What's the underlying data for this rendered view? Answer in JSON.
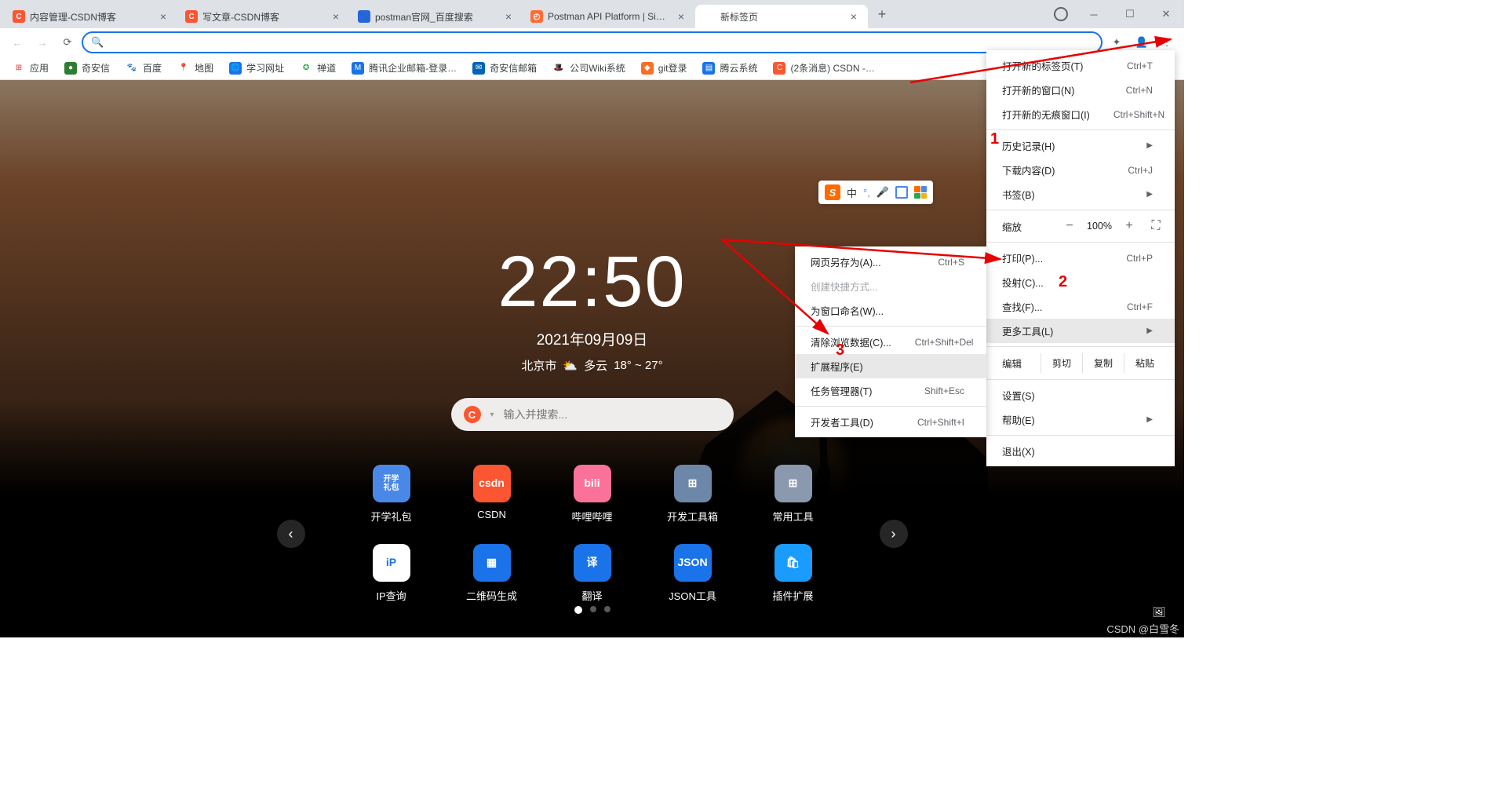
{
  "tabs": [
    {
      "title": "内容管理-CSDN博客",
      "favicon_bg": "#fc5531",
      "favicon_text": "C"
    },
    {
      "title": "写文章-CSDN博客",
      "favicon_bg": "#fc5531",
      "favicon_text": "C"
    },
    {
      "title": "postman官网_百度搜索",
      "favicon_bg": "#2a64dc",
      "favicon_text": "🐾"
    },
    {
      "title": "Postman API Platform | Sign U",
      "favicon_bg": "#ff6c37",
      "favicon_text": "◴"
    },
    {
      "title": "新标签页",
      "favicon_bg": "transparent",
      "favicon_text": "",
      "active": true
    }
  ],
  "bookmarks": [
    {
      "label": "应用",
      "icon_bg": "transparent",
      "icon": "⊞",
      "icon_color": "#d93025"
    },
    {
      "label": "奇安信",
      "icon_bg": "#2e7d32",
      "icon": "●"
    },
    {
      "label": "百度",
      "icon_bg": "#fff",
      "icon": "🐾",
      "icon_color": "#1a73e8"
    },
    {
      "label": "地图",
      "icon_bg": "#fff",
      "icon": "📍"
    },
    {
      "label": "学习网址",
      "icon_bg": "#1a73e8",
      "icon": "🌐",
      "icon_color": "#fff"
    },
    {
      "label": "禅道",
      "icon_bg": "#fff",
      "icon": "✪",
      "icon_color": "#2aa84a"
    },
    {
      "label": "腾讯企业邮箱-登录…",
      "icon_bg": "#1a73e8",
      "icon": "M",
      "icon_color": "#fff"
    },
    {
      "label": "奇安信邮箱",
      "icon_bg": "#0364b8",
      "icon": "✉",
      "icon_color": "#fff"
    },
    {
      "label": "公司Wiki系统",
      "icon_bg": "#fff",
      "icon": "🎩"
    },
    {
      "label": "git登录",
      "icon_bg": "#fc6d26",
      "icon": "◆",
      "icon_color": "#fff"
    },
    {
      "label": "腾云系统",
      "icon_bg": "#1a73e8",
      "icon": "▤",
      "icon_color": "#fff"
    },
    {
      "label": "(2条消息) CSDN -…",
      "icon_bg": "#fc5531",
      "icon": "C",
      "icon_color": "#fff"
    }
  ],
  "ime": {
    "lang": "中"
  },
  "clock": {
    "time": "22:50",
    "date": "2021年09月09日",
    "city": "北京市",
    "weather": "多云",
    "temp": "18° ~ 27°"
  },
  "search": {
    "placeholder": "输入并搜索..."
  },
  "shortcuts_row1": [
    {
      "label": "开学礼包",
      "bg": "#4a88e8",
      "text": "开学\n礼包"
    },
    {
      "label": "CSDN",
      "bg": "#fc5531",
      "text": "csdn"
    },
    {
      "label": "哔哩哔哩",
      "bg": "#fb7299",
      "text": "bili"
    },
    {
      "label": "开发工具箱",
      "bg": "#6d87a8",
      "text": "⊞"
    },
    {
      "label": "常用工具",
      "bg": "#8a99ad",
      "text": "⊞"
    }
  ],
  "shortcuts_row2": [
    {
      "label": "IP查询",
      "bg": "#ffffff",
      "text": "iP",
      "fg": "#1a73e8"
    },
    {
      "label": "二维码生成",
      "bg": "#1a73e8",
      "text": "▦"
    },
    {
      "label": "翻译",
      "bg": "#1a73e8",
      "text": "译"
    },
    {
      "label": "JSON工具",
      "bg": "#1a73e8",
      "text": "JSON"
    },
    {
      "label": "插件扩展",
      "bg": "#1a9cff",
      "text": "🛍"
    }
  ],
  "main_menu": {
    "new_tab": "打开新的标签页(T)",
    "new_tab_sc": "Ctrl+T",
    "new_win": "打开新的窗口(N)",
    "new_win_sc": "Ctrl+N",
    "new_incog": "打开新的无痕窗口(I)",
    "new_incog_sc": "Ctrl+Shift+N",
    "history": "历史记录(H)",
    "downloads": "下载内容(D)",
    "downloads_sc": "Ctrl+J",
    "bookmarks": "书签(B)",
    "zoom_label": "缩放",
    "zoom_value": "100%",
    "print": "打印(P)...",
    "print_sc": "Ctrl+P",
    "cast": "投射(C)...",
    "find": "查找(F)...",
    "find_sc": "Ctrl+F",
    "more_tools": "更多工具(L)",
    "edit_label": "编辑",
    "cut": "剪切",
    "copy": "复制",
    "paste": "粘贴",
    "settings": "设置(S)",
    "help": "帮助(E)",
    "exit": "退出(X)"
  },
  "sub_menu": {
    "save_as": "网页另存为(A)...",
    "save_as_sc": "Ctrl+S",
    "create_shortcut": "创建快捷方式...",
    "name_window": "为窗口命名(W)...",
    "clear_data": "清除浏览数据(C)...",
    "clear_data_sc": "Ctrl+Shift+Del",
    "extensions": "扩展程序(E)",
    "task_mgr": "任务管理器(T)",
    "task_mgr_sc": "Shift+Esc",
    "dev_tools": "开发者工具(D)",
    "dev_tools_sc": "Ctrl+Shift+I"
  },
  "annotations": {
    "a1": "1",
    "a2": "2",
    "a3": "3"
  },
  "disabled_color": "#a0a4a8",
  "watermark": "CSDN @白雪冬"
}
